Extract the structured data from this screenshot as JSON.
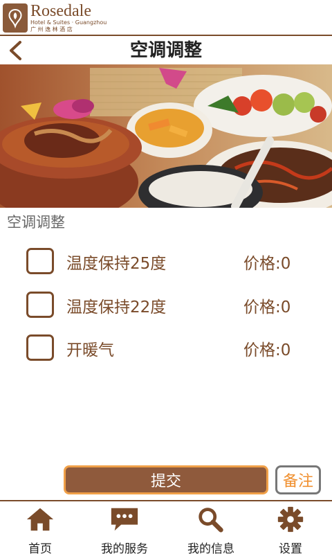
{
  "brand": {
    "name": "Rosedale",
    "subtitle": "Hotel & Suites · Guangzhou",
    "subtitle_cn": "广 州 逸 林 酒 店"
  },
  "header": {
    "title": "空调调整"
  },
  "section": {
    "title": "空调调整"
  },
  "options": [
    {
      "label": "温度保持25度",
      "price": "价格:0",
      "checked": false
    },
    {
      "label": "温度保持22度",
      "price": "价格:0",
      "checked": false
    },
    {
      "label": "开暖气",
      "price": "价格:0",
      "checked": false
    }
  ],
  "actions": {
    "submit_label": "提交",
    "note_label": "备注"
  },
  "tabs": [
    {
      "label": "首页",
      "icon": "home-icon"
    },
    {
      "label": "我的服务",
      "icon": "chat-icon"
    },
    {
      "label": "我的信息",
      "icon": "search-icon"
    },
    {
      "label": "设置",
      "icon": "gear-icon"
    }
  ],
  "colors": {
    "brand_brown": "#7a4b2a",
    "button_fill": "#8f5a3c",
    "button_border": "#f0a048",
    "note_text": "#f09030"
  }
}
